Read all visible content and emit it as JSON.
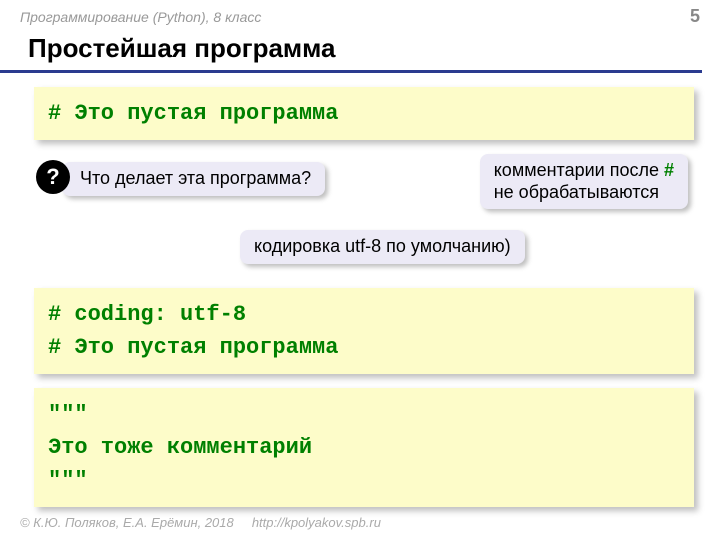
{
  "header": {
    "course": "Программирование (Python), 8 класс",
    "page": "5"
  },
  "title": "Простейшая программа",
  "code1": "# Это пустая программа",
  "question": "Что делает эта программа?",
  "badge": "?",
  "callout1_a": "комментарии после ",
  "callout1_hash": "#",
  "callout1_b": "не обрабатываются",
  "callout2": "кодировка utf-8 по умолчанию)",
  "code2_line1": "# coding: utf-8",
  "code2_line2": "# Это пустая программа",
  "code3_line1": "\"\"\"",
  "code3_line2": "Это тоже комментарий",
  "code3_line3": "\"\"\"",
  "footer_copy": "© К.Ю. Поляков, Е.А. Ерёмин, 2018",
  "footer_url": "http://kpolyakov.spb.ru"
}
